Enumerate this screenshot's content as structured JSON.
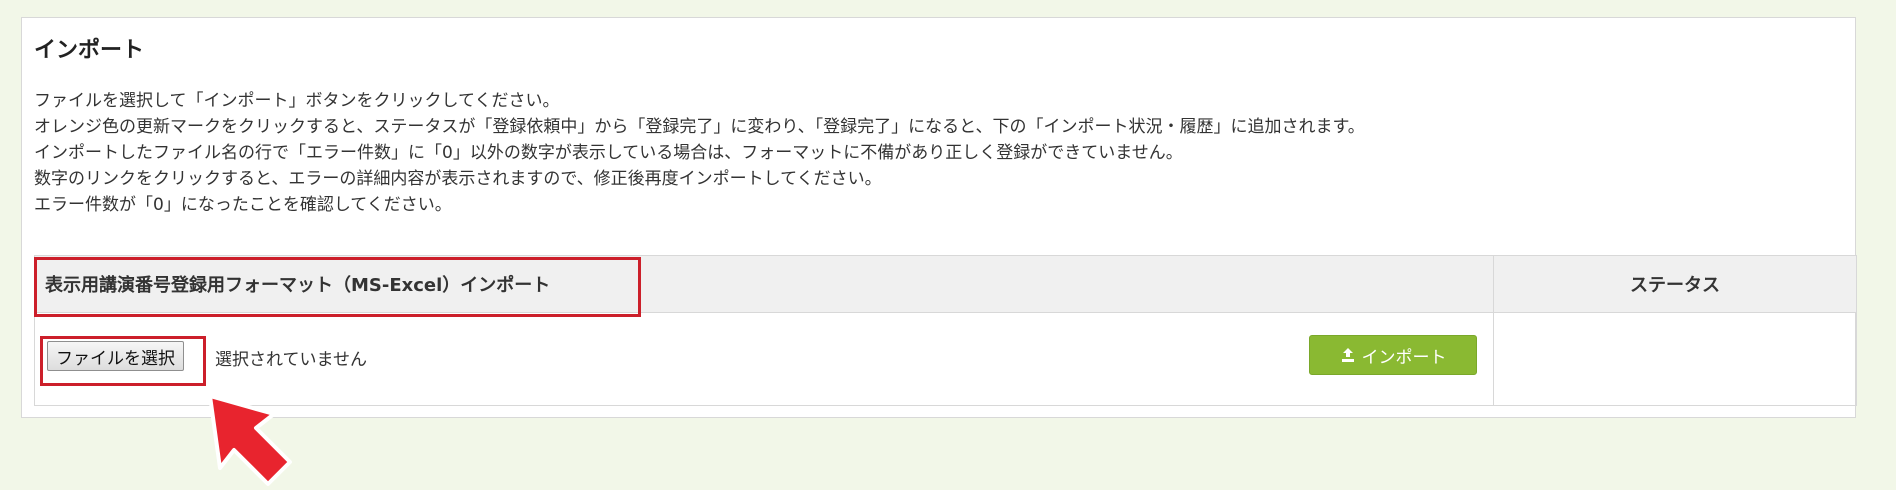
{
  "panel": {
    "title": "インポート",
    "description": [
      "ファイルを選択して「インポート」ボタンをクリックしてください。",
      "オレンジ色の更新マークをクリックすると、ステータスが「登録依頼中」から「登録完了」に変わり、「登録完了」になると、下の「インポート状況・履歴」に追加されます。",
      "インポートしたファイル名の行で「エラー件数」に「0」以外の数字が表示している場合は、フォーマットに不備があり正しく登録ができていません。",
      "数字のリンクをクリックすると、エラーの詳細内容が表示されますので、修正後再度インポートしてください。",
      "エラー件数が「0」になったことを確認してください。"
    ]
  },
  "table": {
    "headers": {
      "format": "表示用講演番号登録用フォーマット（MS-Excel）インポート",
      "status": "ステータス"
    },
    "row": {
      "file_button": "ファイルを選択",
      "file_status": "選択されていません",
      "import_button": "インポート",
      "status_value": ""
    }
  },
  "icons": {
    "upload": "upload-icon",
    "pointer": "arrow-pointer-icon"
  },
  "colors": {
    "background": "#f2f7e8",
    "import_button": "#8ab932",
    "highlight": "#cc1f2a",
    "arrow": "#e8242e"
  }
}
